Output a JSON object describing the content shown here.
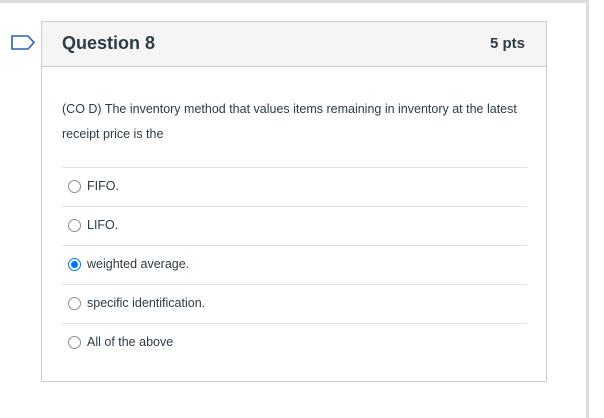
{
  "question": {
    "title": "Question 8",
    "points": "5 pts",
    "text": "(CO D) The inventory method that values items remaining in inventory at the latest receipt price is the",
    "answers": [
      {
        "label": "FIFO.",
        "selected": false
      },
      {
        "label": "LIFO.",
        "selected": false
      },
      {
        "label": "weighted average.",
        "selected": true
      },
      {
        "label": "specific identification.",
        "selected": false
      },
      {
        "label": "All of the above",
        "selected": false
      }
    ]
  },
  "colors": {
    "accent": "#0075ff",
    "flag": "#2d5fb5",
    "header_bg": "#f5f5f5"
  },
  "icons": {
    "flag": "bookmark-flag-icon"
  }
}
